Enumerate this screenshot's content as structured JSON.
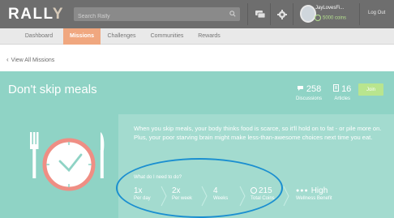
{
  "logo": {
    "text_main": "RALL",
    "text_accent": "Y"
  },
  "search": {
    "placeholder": "Search Rally"
  },
  "user": {
    "name": "JayLovesFi...",
    "coins": "5000 coins"
  },
  "logout_label": "Log Out",
  "nav": {
    "tabs": [
      {
        "label": "Dashboard"
      },
      {
        "label": "Missions"
      },
      {
        "label": "Challenges"
      },
      {
        "label": "Communities"
      },
      {
        "label": "Rewards"
      }
    ]
  },
  "back_link": "View All Missions",
  "mission": {
    "title": "Don't skip meals",
    "discussions_count": "258",
    "discussions_label": "Discussions",
    "articles_count": "16",
    "articles_label": "Articles",
    "join_label": "Join",
    "description": "When you skip meals, your body thinks food is scarce, so it'll hold on to fat - or pile more on. Plus, your poor starving brain might make less-than-awesome choices next time you eat.",
    "what_label": "What do I need to do?",
    "steps": [
      {
        "big": "1x",
        "small": "Per day"
      },
      {
        "big": "2x",
        "small": "Per week"
      },
      {
        "big": "4",
        "small": "Weeks"
      },
      {
        "big": "215",
        "small": "Total Coins"
      },
      {
        "big": "High",
        "small": "Wellness Benefit"
      }
    ]
  },
  "colors": {
    "topbar": "#6e6e6e",
    "active_tab": "#f0a77f",
    "mission_bg": "#8fd3c5",
    "join_button": "#b9e58e",
    "annotation_oval": "#1b8fd0"
  }
}
